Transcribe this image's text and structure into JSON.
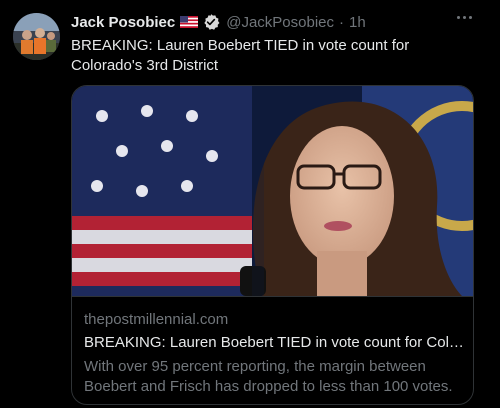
{
  "tweet": {
    "author_name": "Jack Posobiec",
    "handle": "@JackPosobiec",
    "separator": "·",
    "time": "1h",
    "text": "BREAKING: Lauren Boebert TIED in vote count for Colorado's 3rd District"
  },
  "card": {
    "domain": "thepostmillennial.com",
    "title": "BREAKING: Lauren Boebert TIED in vote count for Colo...",
    "description": "With over 95 percent reporting, the margin between Boebert and Frisch has dropped to less than 100 votes."
  },
  "icons": {
    "flag": "us-flag-icon",
    "verified": "verified-badge-icon",
    "more": "more-options-icon"
  },
  "colors": {
    "background": "#000000",
    "text_primary": "#e7e9ea",
    "text_secondary": "#71767b",
    "border": "#2f3336"
  }
}
